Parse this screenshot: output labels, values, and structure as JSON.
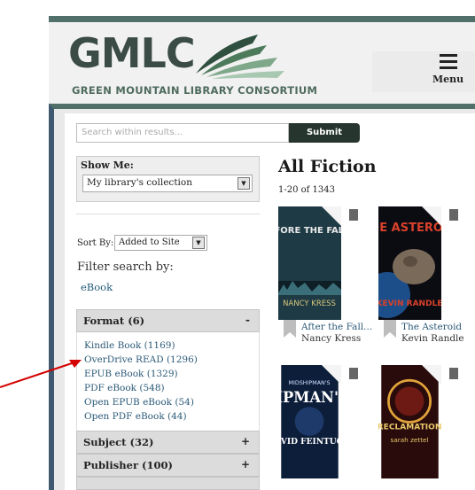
{
  "header": {
    "logo_text": "GMLC",
    "logo_subtitle": "GREEN MOUNTAIN LIBRARY CONSORTIUM",
    "menu_label": "Menu"
  },
  "search": {
    "placeholder": "Search within results...",
    "submit_label": "Submit"
  },
  "sidebar": {
    "show_me_label": "Show Me:",
    "collection_value": "My library's collection",
    "sort_by_label": "Sort By:",
    "sort_value": "Added to Site",
    "filter_label": "Filter search by:",
    "active_filter": "eBook",
    "facets": [
      {
        "title": "Format (6)",
        "toggle": "-"
      },
      {
        "title": "Subject (32)",
        "toggle": "+"
      },
      {
        "title": "Publisher (100)",
        "toggle": "+"
      }
    ],
    "format_items": [
      "Kindle Book (1169)",
      "OverDrive READ (1296)",
      "EPUB eBook (1329)",
      "PDF eBook (548)",
      "Open EPUB eBook (54)",
      "Open PDF eBook (44)"
    ]
  },
  "results": {
    "title": "All Fiction",
    "count": "1-20 of 1343",
    "books": [
      {
        "title": "After the Fall...",
        "author": "Nancy Kress",
        "cover_top_text": "AFTER THE FALL BEFORE THE FALL DURING THE FALL",
        "cover_author": "NANCY KRESS"
      },
      {
        "title": "The Asteroid",
        "author": "Kevin Randle",
        "cover_top_text": "THE ASTEROID",
        "cover_author": "KEVIN RANDLE"
      },
      {
        "title": "",
        "author": "",
        "cover_top_text": "MIDSHIPMAN'S HOPE",
        "cover_author": "DAVID FEINTUCH"
      },
      {
        "title": "",
        "author": "",
        "cover_top_text": "RECLAMATION",
        "cover_author": "sarah zettel"
      }
    ]
  },
  "colors": {
    "accent_green": "#52706a",
    "frame_blue": "#3f5a70",
    "link_blue": "#2b5a78",
    "annotation_arrow": "#d40000"
  }
}
